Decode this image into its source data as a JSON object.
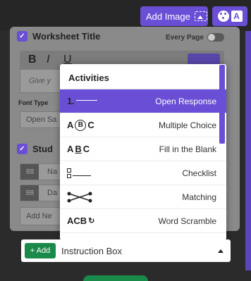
{
  "toolbar": {
    "add_image_label": "Add Image",
    "add_image_icon": "image-icon",
    "style_icons": [
      "palette-icon",
      "font-icon"
    ],
    "font_icon_letter": "A",
    "accent_color": "#6a4fd6"
  },
  "panel": {
    "worksheet_title_label": "Worksheet Title",
    "every_page_label": "Every Page",
    "format_buttons": [
      "B",
      "I",
      "U"
    ],
    "title_placeholder_partial": "Give y",
    "font_type_label": "Font Type",
    "font_type_value_partial": "Open Sa",
    "student_section_partial": "Stud",
    "student_field_1_partial": "Na",
    "student_field_2_partial": "Da",
    "add_field_partial": "Add Ne"
  },
  "dropdown": {
    "header": "Activities",
    "items": [
      {
        "icon": "numbered-line-icon",
        "icon_text": "1.",
        "label": "Open Response",
        "selected": true
      },
      {
        "icon": "multiple-choice-icon",
        "icon_text": [
          "A",
          "B",
          "C"
        ],
        "label": "Multiple Choice",
        "selected": false
      },
      {
        "icon": "fill-blank-icon",
        "icon_text": [
          "A",
          "B",
          "C"
        ],
        "label": "Fill in the Blank",
        "selected": false
      },
      {
        "icon": "checklist-icon",
        "label": "Checklist",
        "selected": false
      },
      {
        "icon": "matching-icon",
        "label": "Matching",
        "selected": false
      },
      {
        "icon": "word-scramble-icon",
        "icon_text": "ACB",
        "label": "Word Scramble",
        "selected": false
      }
    ]
  },
  "bottom": {
    "add_button_label": "+ Add",
    "selected_option": "Instruction Box",
    "add_button_color": "#1a8a4a"
  }
}
